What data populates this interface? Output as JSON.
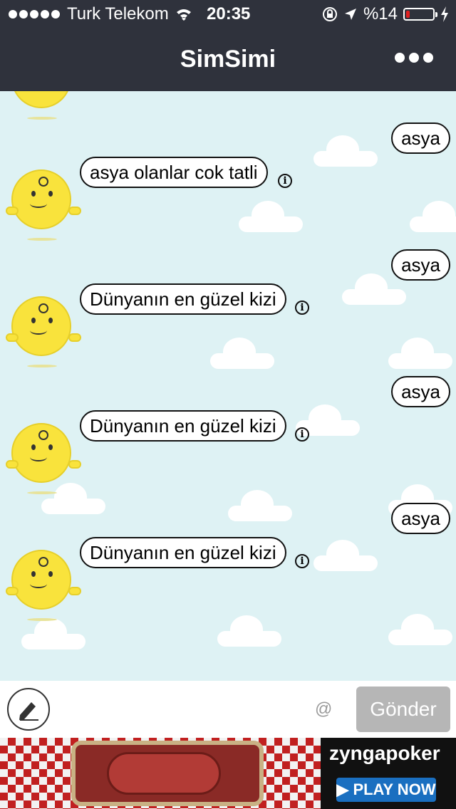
{
  "status_bar": {
    "carrier": "Turk Telekom",
    "time": "20:35",
    "battery_percent": "%14",
    "battery_level": 0.14,
    "battery_color": "#e02020"
  },
  "header": {
    "title": "SimSimi",
    "menu_icon": "more-dots-icon"
  },
  "messages": [
    {
      "from": "user",
      "text": "asya"
    },
    {
      "from": "bot",
      "text": "asya olanlar cok tatli"
    },
    {
      "from": "user",
      "text": "asya"
    },
    {
      "from": "bot",
      "text": "Dünyanın en güzel kizi"
    },
    {
      "from": "user",
      "text": "asya"
    },
    {
      "from": "bot",
      "text": "Dünyanın en güzel kizi"
    },
    {
      "from": "user",
      "text": "asya"
    },
    {
      "from": "bot",
      "text": "Dünyanın en güzel kizi"
    }
  ],
  "info_icon_glyph": "i",
  "input_bar": {
    "edit_icon": "pencil-icon",
    "at_label": "@",
    "send_label": "Gönder",
    "text_value": ""
  },
  "ad": {
    "brand_text": "zyngapoker",
    "cta_label": "▶ PLAY NOW"
  },
  "colors": {
    "header_bg": "#2f323c",
    "chat_bg": "#def2f4",
    "avatar_yellow": "#f9e33c",
    "send_button": "#b6b6b6"
  }
}
